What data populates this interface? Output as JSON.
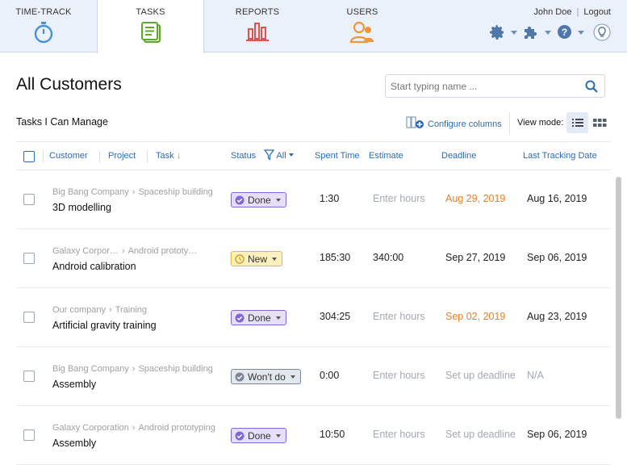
{
  "nav": {
    "tabs": [
      {
        "label": "TIME-TRACK",
        "icon": "stopwatch-icon"
      },
      {
        "label": "TASKS",
        "icon": "tasks-icon"
      },
      {
        "label": "REPORTS",
        "icon": "reports-icon"
      },
      {
        "label": "USERS",
        "icon": "users-icon"
      }
    ],
    "user_name": "John Doe",
    "separator": "|",
    "logout": "Logout"
  },
  "page": {
    "title": "All Customers",
    "search_placeholder": "Start typing name ...",
    "subtitle": "Tasks I Can Manage",
    "configure_columns": "Configure columns",
    "view_mode_label": "View mode:"
  },
  "table": {
    "headers": {
      "customer": "Customer",
      "project": "Project",
      "task": "Task",
      "status": "Status",
      "status_filter": "All",
      "spent_time": "Spent Time",
      "estimate": "Estimate",
      "deadline": "Deadline",
      "last_tracking_date": "Last Tracking Date"
    },
    "rows": [
      {
        "customer": "Big Bang Company",
        "project": "Spaceship building",
        "task": "3D modelling",
        "status": "Done",
        "status_type": "done",
        "spent": "1:30",
        "estimate": "Enter hours",
        "deadline": "Aug 29, 2019",
        "deadline_style": "orange",
        "last_tracking": "Aug 16, 2019",
        "last_style": "normal"
      },
      {
        "customer": "Galaxy Corpor…",
        "project": "Android prototy…",
        "task": "Android calibration",
        "status": "New",
        "status_type": "new",
        "spent": "185:30",
        "estimate": "340:00",
        "deadline": "Sep 27, 2019",
        "deadline_style": "normal",
        "last_tracking": "Sep 06, 2019",
        "last_style": "normal"
      },
      {
        "customer": "Our company",
        "project": "Training",
        "task": "Artificial gravity training",
        "status": "Done",
        "status_type": "done",
        "spent": "304:25",
        "estimate": "Enter hours",
        "deadline": "Sep 02, 2019",
        "deadline_style": "orange",
        "last_tracking": "Aug 23, 2019",
        "last_style": "normal"
      },
      {
        "customer": "Big Bang Company",
        "project": "Spaceship building",
        "task": "Assembly",
        "status": "Won't do",
        "status_type": "wont",
        "spent": "0:00",
        "estimate": "Enter hours",
        "deadline": "Set up deadline",
        "deadline_style": "muted",
        "last_tracking": "N/A",
        "last_style": "muted"
      },
      {
        "customer": "Galaxy Corporation",
        "project": "Android prototyping",
        "task": "Assembly",
        "status": "Done",
        "status_type": "done",
        "spent": "10:50",
        "estimate": "Enter hours",
        "deadline": "Set up deadline",
        "deadline_style": "muted",
        "last_tracking": "Sep 06, 2019",
        "last_style": "normal"
      }
    ]
  },
  "colors": {
    "accent": "#2b6cb0",
    "deadline_warning": "#ef7c22",
    "done": "#7d6ad3",
    "new": "#e6b82a",
    "wont": "#7b8796",
    "nav_bg": "#eaf1fb"
  }
}
